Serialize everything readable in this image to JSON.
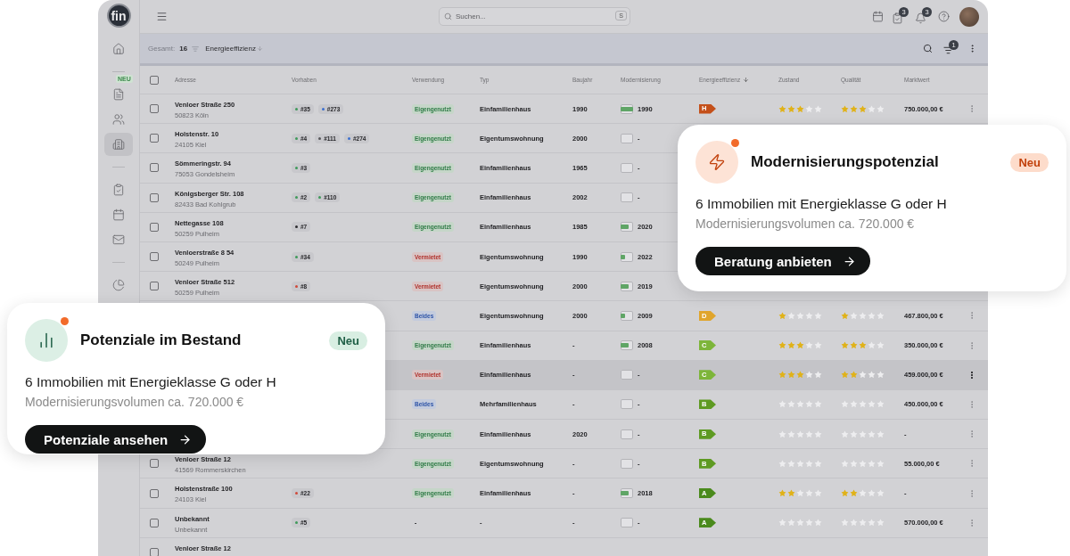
{
  "sidebar": {
    "logo": "fin",
    "groups": [
      [
        {
          "kind": "home",
          "selected": false
        }
      ],
      [
        {
          "kind": "docs",
          "badge": "NEU",
          "selected": false
        },
        {
          "kind": "people",
          "selected": false
        },
        {
          "kind": "building",
          "selected": true
        }
      ],
      [
        {
          "kind": "tasks",
          "selected": false
        },
        {
          "kind": "calendar",
          "selected": false
        },
        {
          "kind": "mail",
          "selected": false
        }
      ],
      [
        {
          "kind": "chart"
        }
      ]
    ]
  },
  "topbar": {
    "search": {
      "placeholder": "Suchen...",
      "shortcut": "S"
    },
    "icons": [
      {
        "kind": "calendar"
      },
      {
        "kind": "tasks",
        "badge": "3"
      },
      {
        "kind": "bell",
        "badge": "3"
      },
      {
        "kind": "help"
      }
    ]
  },
  "toolbar": {
    "total_label": "Gesamt:",
    "total": "16",
    "sort": "Energieeffizienz",
    "filter_badge": "1"
  },
  "select_all": {
    "checked": false
  },
  "columns": [
    {
      "label": "Adresse",
      "sorted": false
    },
    {
      "label": "Vorhaben",
      "sorted": false
    },
    {
      "label": "Verwendung",
      "sorted": false
    },
    {
      "label": "Typ",
      "sorted": false
    },
    {
      "label": "Baujahr",
      "sorted": false
    },
    {
      "label": "Modernisierung",
      "sorted": false
    },
    {
      "label": "Energieeffizienz",
      "sorted": true
    },
    {
      "label": "Zustand",
      "sorted": false
    },
    {
      "label": "Qualität",
      "sorted": false
    },
    {
      "label": "Marktwert",
      "sorted": false
    }
  ],
  "rows": [
    {
      "highlighted": false,
      "checked": false,
      "street": "Venloer Straße 250",
      "city": "50823 Köln",
      "projects": [
        {
          "label": "#35",
          "color": "#3f9a5a"
        },
        {
          "label": "#273",
          "color": "#3b6fd0"
        }
      ],
      "usage": {
        "kind": "own",
        "label": "Eigengenutzt"
      },
      "type": "Einfamilienhaus",
      "year": "1990",
      "modernization": {
        "level": 1,
        "year": "1990"
      },
      "energy": {
        "label": "H",
        "color": "#c4501a"
      },
      "condition": {
        "stars": 3
      },
      "quality": {
        "stars": 3
      },
      "value": "750.000,00 €"
    },
    {
      "checked": false,
      "street": "Holstenstr. 10",
      "city": "24105 Kiel",
      "projects": [
        {
          "label": "#4",
          "color": "#3f9a5a"
        },
        {
          "label": "#111",
          "color": "#555558"
        },
        {
          "label": "#274",
          "color": "#3b6fd0"
        }
      ],
      "usage": {
        "kind": "own",
        "label": "Eigengenutzt"
      },
      "type": "Eigentumswohnung",
      "year": "2000",
      "modernization": {
        "level": 0,
        "year": "-"
      }
    },
    {
      "checked": false,
      "street": "Sömmeringstr. 94",
      "city": "75053 Gondelsheim",
      "projects": [
        {
          "label": "#3",
          "color": "#3f9a5a"
        }
      ],
      "usage": {
        "kind": "own",
        "label": "Eigengenutzt"
      },
      "type": "Einfamilienhaus",
      "year": "1965",
      "modernization": {
        "level": 0,
        "year": "-"
      }
    },
    {
      "checked": false,
      "street": "Königsberger Str. 108",
      "city": "82433 Bad Kohlgrub",
      "projects": [
        {
          "label": "#2",
          "color": "#3f9a5a"
        },
        {
          "label": "#110",
          "color": "#3f9a5a"
        }
      ],
      "usage": {
        "kind": "own",
        "label": "Eigengenutzt"
      },
      "type": "Einfamilienhaus",
      "year": "2002",
      "modernization": {
        "level": 0,
        "year": "-"
      }
    },
    {
      "checked": false,
      "street": "Nettegasse 108",
      "city": "50259 Pulheim",
      "projects": [
        {
          "label": "#7",
          "color": "#2d2d30"
        }
      ],
      "usage": {
        "kind": "own",
        "label": "Eigengenutzt"
      },
      "type": "Einfamilienhaus",
      "year": "1985",
      "modernization": {
        "level": 0.67,
        "year": "2020"
      }
    },
    {
      "checked": false,
      "street": "Venloerstraße 8 54",
      "city": "50249 Pulheim",
      "projects": [
        {
          "label": "#34",
          "color": "#3f9a5a"
        }
      ],
      "usage": {
        "kind": "rented",
        "label": "Vermietet"
      },
      "type": "Eigentumswohnung",
      "year": "1990",
      "modernization": {
        "level": 0.33,
        "year": "2022"
      }
    },
    {
      "checked": false,
      "street": "Venloer Straße 512",
      "city": "50259 Pulheim",
      "projects": [
        {
          "label": "#8",
          "color": "#d04a3a"
        }
      ],
      "usage": {
        "kind": "rented",
        "label": "Vermietet"
      },
      "type": "Eigentumswohnung",
      "year": "2000",
      "modernization": {
        "level": 0.67,
        "year": "2019"
      }
    },
    {
      "highlighted": false,
      "usage": {
        "kind": "both",
        "label": "Beides"
      },
      "type": "Eigentumswohnung",
      "year": "2000",
      "modernization": {
        "level": 0.33,
        "year": "2009"
      },
      "energy": {
        "label": "D",
        "color": "#e0a52c"
      },
      "condition": {
        "stars": 1
      },
      "quality": {
        "stars": 1
      },
      "value": "467.800,00 €"
    },
    {
      "highlighted": false,
      "usage": {
        "kind": "own",
        "label": "Eigengenutzt"
      },
      "type": "Einfamilienhaus",
      "year": "-",
      "modernization": {
        "level": 0.67,
        "year": "2008"
      },
      "energy": {
        "label": "C",
        "color": "#7db53a"
      },
      "condition": {
        "stars": 3
      },
      "quality": {
        "stars": 3
      },
      "value": "350.000,00 €"
    },
    {
      "highlighted": true,
      "usage": {
        "kind": "rented",
        "label": "Vermietet"
      },
      "type": "Einfamilienhaus",
      "year": "-",
      "modernization": {
        "level": 0,
        "year": "-"
      },
      "energy": {
        "label": "C",
        "color": "#7db53a"
      },
      "condition": {
        "stars": 3
      },
      "quality": {
        "stars": 2
      },
      "value": "459.000,00 €"
    },
    {
      "highlighted": false,
      "usage": {
        "kind": "both",
        "label": "Beides"
      },
      "type": "Mehrfamilienhaus",
      "year": "-",
      "modernization": {
        "level": 0,
        "year": "-"
      },
      "energy": {
        "label": "B",
        "color": "#5e9a22"
      },
      "condition": {
        "stars": 0
      },
      "quality": {
        "stars": 0
      },
      "value": "450.000,00 €"
    },
    {
      "highlighted": false,
      "usage": {
        "kind": "own",
        "label": "Eigengenutzt"
      },
      "type": "Einfamilienhaus",
      "year": "2020",
      "modernization": {
        "level": 0,
        "year": "-"
      },
      "energy": {
        "label": "B",
        "color": "#5e9a22"
      },
      "condition": {
        "stars": 0
      },
      "quality": {
        "stars": 0
      },
      "value": "-"
    },
    {
      "highlighted": false,
      "checked": false,
      "street": "Venloer Straße 12",
      "city": "41569 Rommerskirchen",
      "usage": {
        "kind": "own",
        "label": "Eigengenutzt"
      },
      "type": "Eigentumswohnung",
      "year": "-",
      "modernization": {
        "level": 0,
        "year": "-"
      },
      "energy": {
        "label": "B",
        "color": "#5e9a22"
      },
      "condition": {
        "stars": 0
      },
      "quality": {
        "stars": 0
      },
      "value": "55.000,00 €"
    },
    {
      "highlighted": false,
      "checked": false,
      "street": "Holstenstraße 100",
      "city": "24103 Kiel",
      "projects": [
        {
          "label": "#22",
          "color": "#d04a3a"
        }
      ],
      "usage": {
        "kind": "own",
        "label": "Eigengenutzt"
      },
      "type": "Einfamilienhaus",
      "year": "-",
      "modernization": {
        "level": 0.67,
        "year": "2018"
      },
      "energy": {
        "label": "A",
        "color": "#4a8a1c"
      },
      "condition": {
        "stars": 2
      },
      "quality": {
        "stars": 2
      },
      "value": "-"
    },
    {
      "highlighted": false,
      "checked": false,
      "street": "Unbekannt",
      "city": "Unbekannt",
      "projects": [
        {
          "label": "#5",
          "color": "#3f9a5a"
        }
      ],
      "usage": {
        "kind": "none",
        "label": "-"
      },
      "type": "-",
      "year": "-",
      "modernization": {
        "level": 0,
        "year": "-"
      },
      "energy": {
        "label": "A",
        "color": "#4a8a1c"
      },
      "condition": {
        "stars": 0
      },
      "quality": {
        "stars": 0
      },
      "value": "570.000,00 €"
    },
    {
      "checked": false,
      "street": "Venloer Straße 12"
    }
  ],
  "cards": [
    {
      "kind": "energy",
      "title": "Modernisierungspotenzial",
      "badge": "Neu",
      "text": "6 Immobilien mit Energieklasse G oder H",
      "subtext": "Modernisierungsvolumen ca. 720.000 €",
      "button": "Beratung anbieten"
    },
    {
      "kind": "potential",
      "title": "Potenziale im Bestand",
      "badge": "Neu",
      "text": "6 Immobilien mit Energieklasse G oder H",
      "subtext": "Modernisierungsvolumen ca. 720.000 €",
      "button": "Potenziale ansehen"
    }
  ]
}
